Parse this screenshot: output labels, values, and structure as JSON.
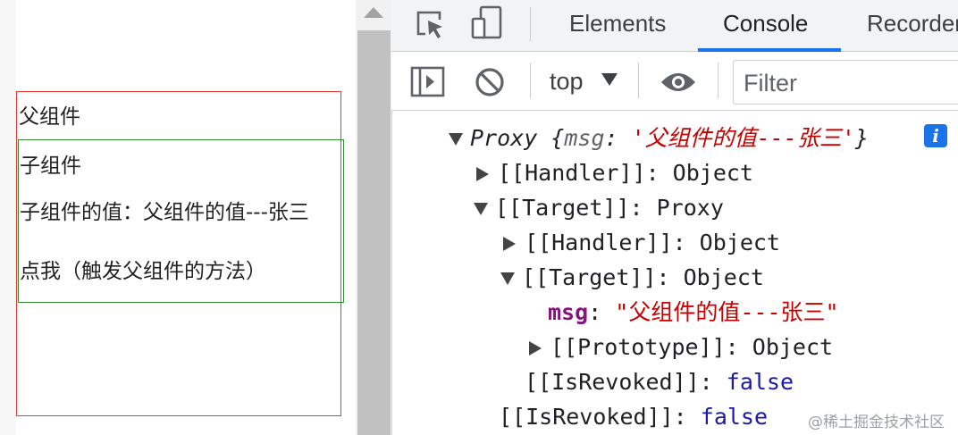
{
  "page": {
    "parent_label": "父组件",
    "child_label": "子组件",
    "child_value_text": "子组件的值：父组件的值---张三",
    "child_button_text": "点我（触发父组件的方法）"
  },
  "devtools": {
    "tabs": [
      "Elements",
      "Console",
      "Recorder"
    ],
    "active_tab": "Console",
    "toolbar": {
      "context": "top",
      "filter_placeholder": "Filter"
    },
    "console": {
      "proxy_prefix": "Proxy {",
      "proxy_key": "msg",
      "proxy_value": "'父组件的值---张三'",
      "proxy_suffix": "}",
      "rows": [
        {
          "label": "[[Handler]]: ",
          "value": "Object"
        },
        {
          "label": "[[Target]]: ",
          "value": "Proxy"
        },
        {
          "label": "[[Handler]]: ",
          "value": "Object"
        },
        {
          "label": "[[Target]]: ",
          "value": "Object"
        },
        {
          "key": "msg",
          "sep": ": ",
          "value": "\"父组件的值---张三\""
        },
        {
          "label": "[[Prototype]]: ",
          "value": "Object"
        },
        {
          "label": "[[IsRevoked]]: ",
          "value": "false"
        },
        {
          "label": "[[IsRevoked]]: ",
          "value": "false"
        }
      ],
      "info_icon": "i"
    }
  },
  "watermark": "@稀土掘金技术社区",
  "colors": {
    "parent_border": "#e53935",
    "child_border": "#2e8b2e",
    "accent": "#1a73e8",
    "string": "#c80000",
    "key": "#881280",
    "keyword": "#1a1aa6"
  }
}
